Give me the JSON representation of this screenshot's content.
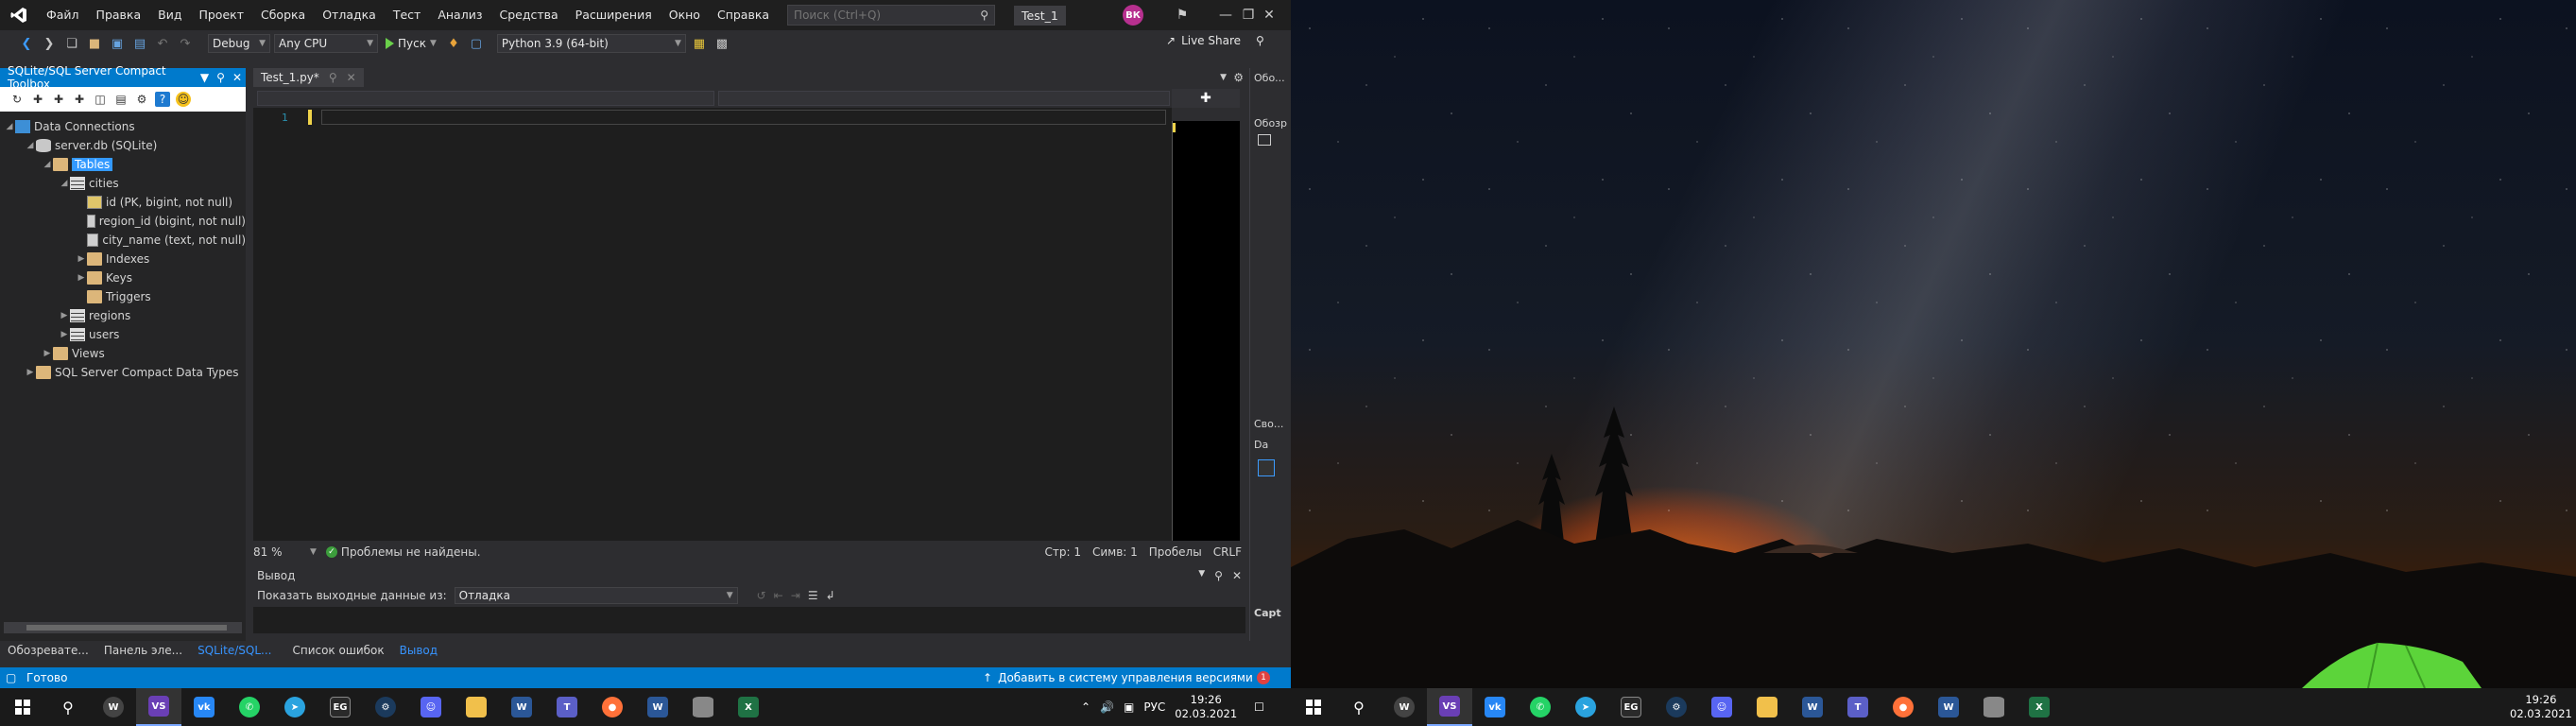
{
  "menu": [
    "Файл",
    "Правка",
    "Вид",
    "Проект",
    "Сборка",
    "Отладка",
    "Тест",
    "Анализ",
    "Средства",
    "Расширения",
    "Окно",
    "Справка"
  ],
  "search": {
    "placeholder": "Поиск (Ctrl+Q)"
  },
  "solution_name": "Test_1",
  "user_initials": "ВК",
  "toolbar": {
    "config": "Debug",
    "platform": "Any CPU",
    "run_label": "Пуск",
    "python_env": "Python 3.9 (64-bit)",
    "live_share": "Live Share"
  },
  "toolbox": {
    "title": "SQLite/SQL Server Compact Toolbox",
    "tree": {
      "root": "Data Connections",
      "db": "server.db (SQLite)",
      "tables": "Tables",
      "cities": "cities",
      "col_id": "id (PK, bigint, not null)",
      "col_region": "region_id (bigint, not null)",
      "col_city": "city_name (text, not null)",
      "indexes": "Indexes",
      "keys": "Keys",
      "triggers": "Triggers",
      "regions": "regions",
      "users": "users",
      "views": "Views",
      "types": "SQL Server Compact Data Types"
    }
  },
  "bottom_tabs": [
    "Обозревате...",
    "Панель эле...",
    "SQLite/SQL...",
    "Список ошибок",
    "Вывод"
  ],
  "editor": {
    "tab_name": "Test_1.py*",
    "line_number": "1",
    "zoom": "81 %",
    "problems": "Проблемы не найдены.",
    "line": "Стр: 1",
    "col": "Симв: 1",
    "spaces": "Пробелы",
    "eol": "CRLF"
  },
  "output": {
    "title": "Вывод",
    "show_label": "Показать выходные данные из:",
    "source": "Отладка"
  },
  "side": {
    "obz1": "Обо...",
    "obz2": "Обозр",
    "svo": "Сво...",
    "da": "Da",
    "capt": "Capt"
  },
  "statusbar": {
    "ready": "Готово",
    "vcs": "Добавить в систему управления версиями",
    "notifications": "1"
  },
  "tray": {
    "lang": "РУС",
    "time": "19:26",
    "date": "02.03.2021"
  },
  "colors": {
    "accent": "#007acc",
    "selection": "#3399ff",
    "editor_bg": "#1e1e1e",
    "chrome_bg": "#2d2d30"
  }
}
